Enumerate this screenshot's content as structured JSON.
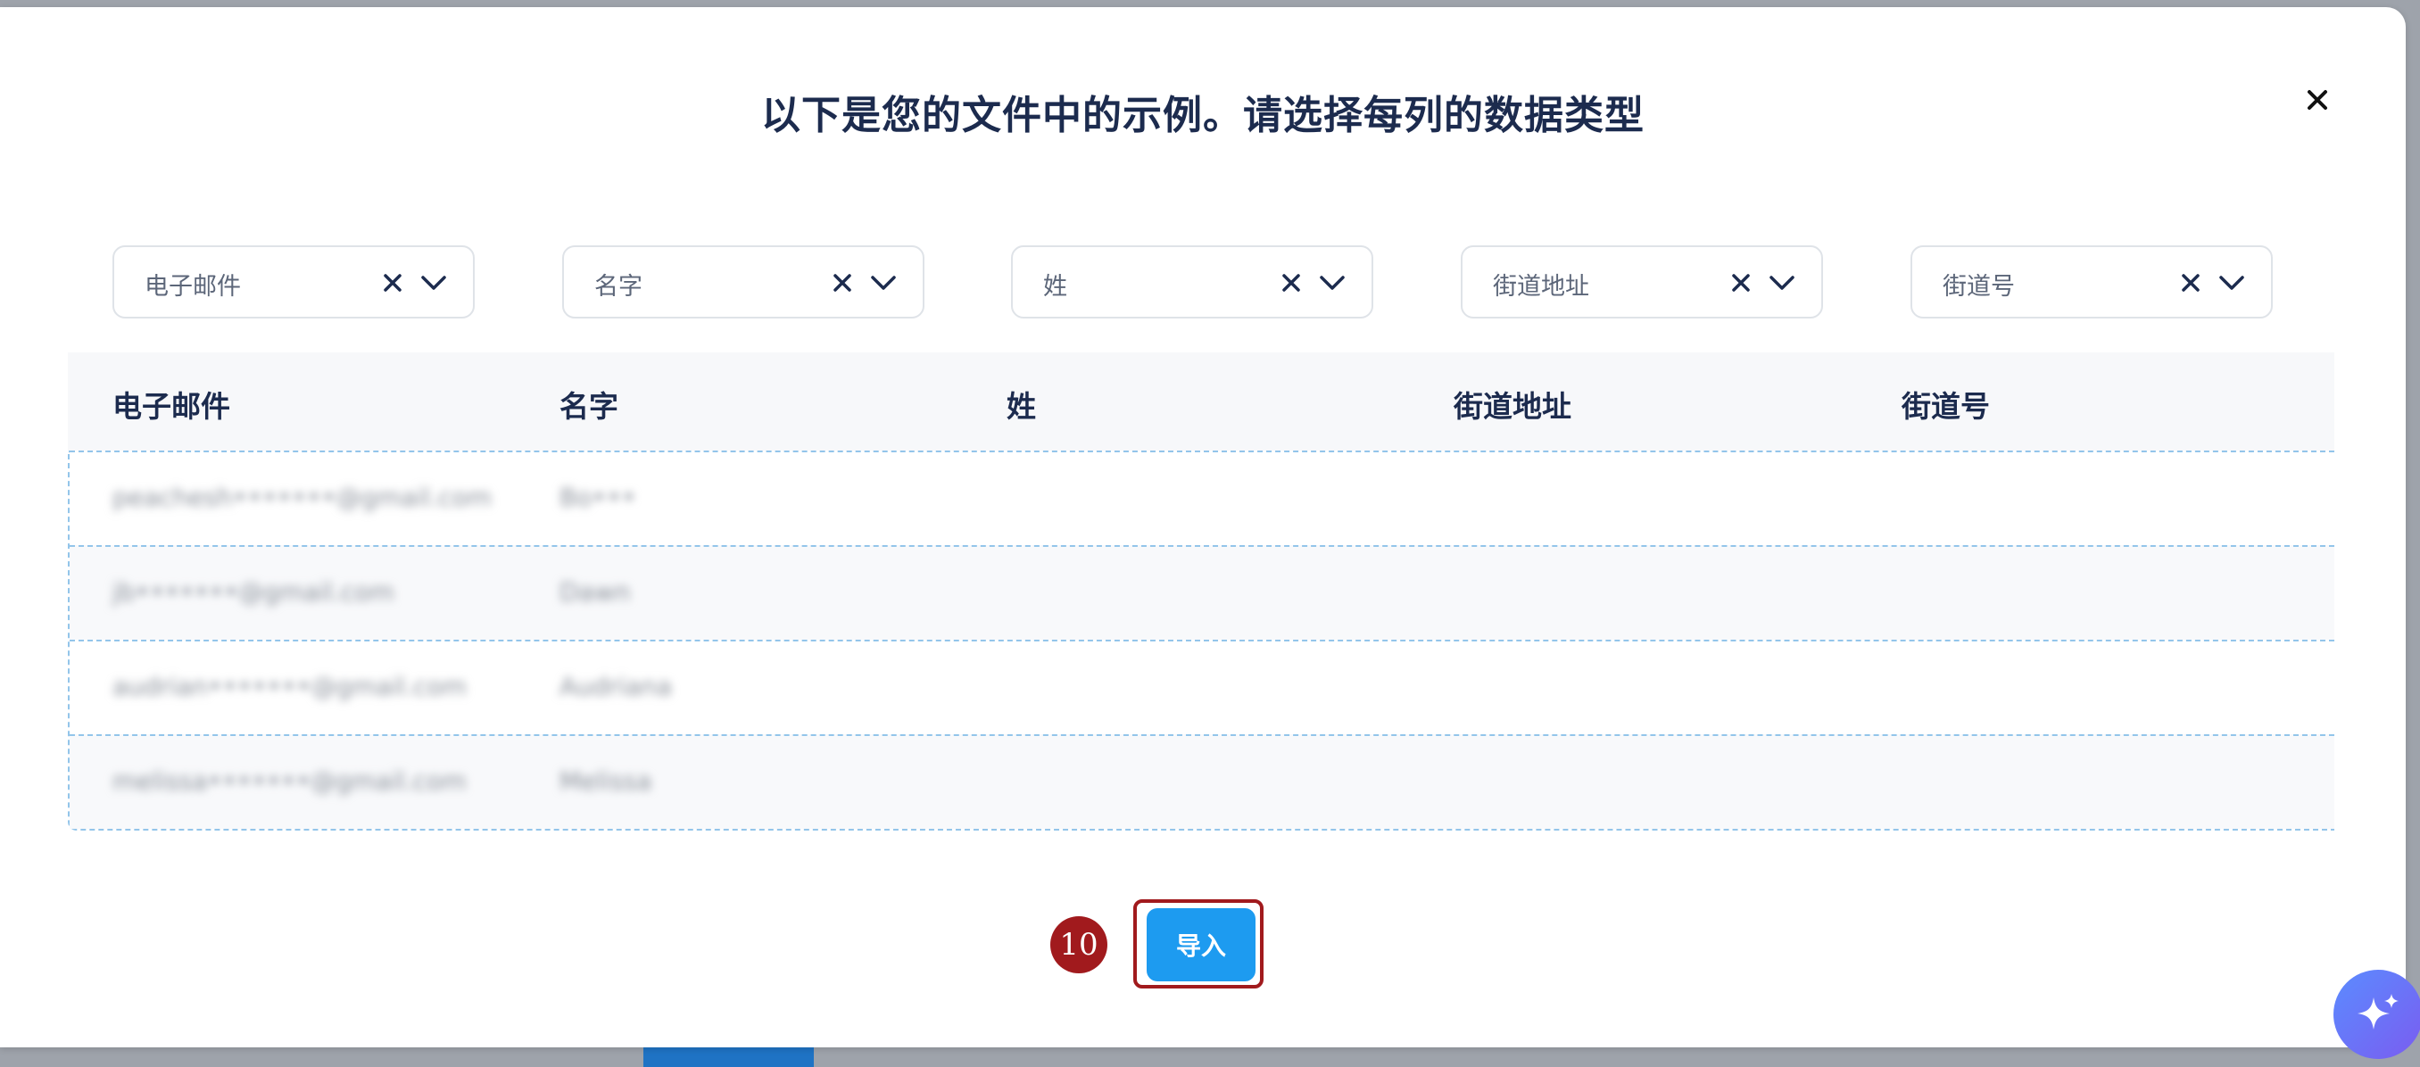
{
  "modal": {
    "title": "以下是您的文件中的示例。请选择每列的数据类型",
    "close_icon": "close-icon"
  },
  "column_selects": [
    {
      "value": "电子邮件"
    },
    {
      "value": "名字"
    },
    {
      "value": "姓"
    },
    {
      "value": "街道地址"
    },
    {
      "value": "街道号"
    }
  ],
  "table": {
    "headers": [
      "电子邮件",
      "名字",
      "姓",
      "街道地址",
      "街道号"
    ],
    "rows": [
      [
        "peachesh•••••••@gmail.com",
        "Bo•••"
      ],
      [
        "jb•••••••@gmail.com",
        "Dawn"
      ],
      [
        "audrian•••••••@gmail.com",
        "Audriana"
      ],
      [
        "melissa•••••••@gmail.com",
        "Melissa"
      ]
    ]
  },
  "footer": {
    "step_number": "10",
    "import_label": "导入"
  },
  "colors": {
    "primary": "#1d9bf0",
    "title": "#1c2b4e",
    "highlight": "#a11a1d"
  }
}
